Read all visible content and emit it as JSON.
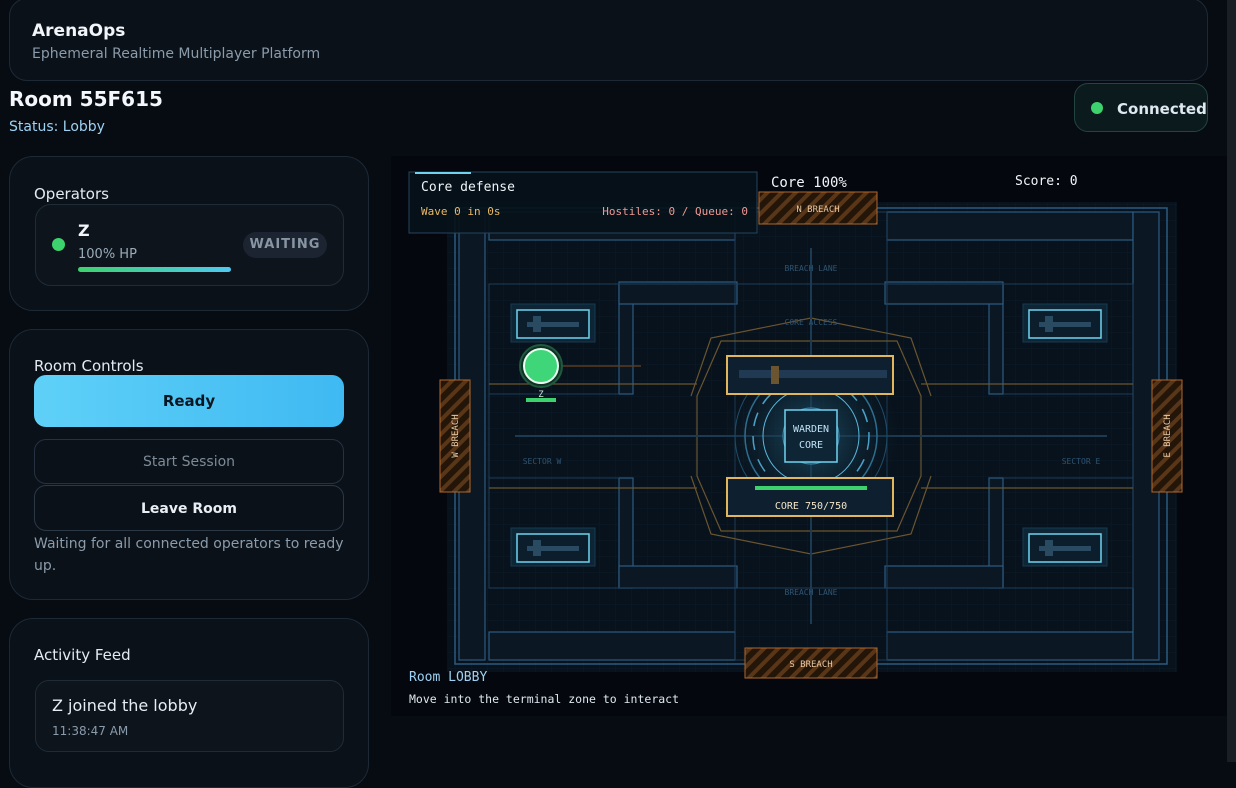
{
  "app": {
    "title": "ArenaOps",
    "subtitle": "Ephemeral Realtime Multiplayer Platform"
  },
  "room": {
    "title": "Room 55F615",
    "status": "Status: Lobby"
  },
  "connection": {
    "label": "Connected",
    "color": "#3dd26e"
  },
  "operators": {
    "heading": "Operators",
    "list": [
      {
        "name": "Z",
        "hp_text": "100% HP",
        "hp_fraction": 1.0,
        "status": "WAITING"
      }
    ]
  },
  "controls": {
    "heading": "Room Controls",
    "ready_label": "Ready",
    "start_label": "Start Session",
    "leave_label": "Leave Room",
    "note": "Waiting for all connected operators to ready up."
  },
  "activity": {
    "heading": "Activity Feed",
    "items": [
      {
        "text": "Z joined the lobby",
        "time": "11:38:47 AM"
      }
    ]
  },
  "hud": {
    "mode": "Core defense",
    "wave": "Wave 0 in 0s",
    "hostiles": "Hostiles: 0 / Queue: 0",
    "core": "Core 100%",
    "score": "Score: 0",
    "room_state": "Room LOBBY",
    "hint": "Move into the terminal zone to interact"
  },
  "map": {
    "breach_north": "N BREACH",
    "breach_south": "S BREACH",
    "breach_west": "W BREACH",
    "breach_east": "E BREACH",
    "lane_north": "BREACH LANE",
    "lane_south": "BREACH LANE",
    "core_access": "CORE ACCESS",
    "sector_west": "SECTOR W",
    "sector_east": "SECTOR E",
    "core_line1": "WARDEN",
    "core_line2": "CORE",
    "core_hp": "CORE 750/750",
    "core_hp_fraction": 1.0,
    "player_label": "Z",
    "player_hp_fraction": 1.0
  },
  "colors": {
    "accent": "#4fc9f0",
    "ok": "#3dd26e",
    "warn": "#e0b25a",
    "breach": "#c67a3a"
  }
}
